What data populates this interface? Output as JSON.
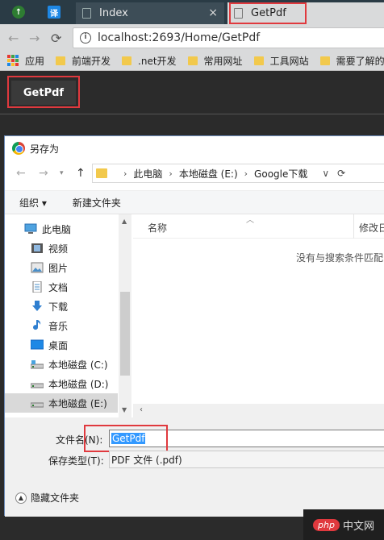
{
  "browser": {
    "pinned_tab_1_glyph": "↑",
    "pinned_tab_2_glyph": "译",
    "tabs": [
      {
        "title": "Index",
        "close": "×"
      },
      {
        "title": "GetPdf",
        "close": "×"
      }
    ],
    "url": "localhost:2693/Home/GetPdf",
    "nav": {
      "back": "←",
      "forward": "→",
      "reload": "⟳"
    },
    "bookmarks": [
      {
        "label": "应用"
      },
      {
        "label": "前端开发"
      },
      {
        "label": ".net开发"
      },
      {
        "label": "常用网址"
      },
      {
        "label": "工具网站"
      },
      {
        "label": "需要了解的内"
      }
    ]
  },
  "page": {
    "button_label": "GetPdf"
  },
  "dialog": {
    "title": "另存为",
    "breadcrumb": [
      "此电脑",
      "本地磁盘 (E:)",
      "Google下载"
    ],
    "command_bar": {
      "organize": "组织 ▾",
      "new_folder": "新建文件夹"
    },
    "nav_items": [
      {
        "label": "此电脑",
        "icon": "computer-icon"
      },
      {
        "label": "视频",
        "icon": "video-icon"
      },
      {
        "label": "图片",
        "icon": "pictures-icon"
      },
      {
        "label": "文档",
        "icon": "documents-icon"
      },
      {
        "label": "下载",
        "icon": "downloads-icon"
      },
      {
        "label": "音乐",
        "icon": "music-icon"
      },
      {
        "label": "桌面",
        "icon": "desktop-icon"
      },
      {
        "label": "本地磁盘 (C:)",
        "icon": "drive-icon"
      },
      {
        "label": "本地磁盘 (D:)",
        "icon": "drive-icon"
      },
      {
        "label": "本地磁盘 (E:)",
        "icon": "drive-icon",
        "selected": true
      }
    ],
    "columns": {
      "name": "名称",
      "modified": "修改日"
    },
    "empty_message": "没有与搜索条件匹配",
    "filename_label": "文件名(N):",
    "filename_value": "GetPdf",
    "filetype_label": "保存类型(T):",
    "filetype_value": "PDF 文件 (.pdf)",
    "hide_folders": "隐藏文件夹"
  },
  "watermark": {
    "logo": "php",
    "text": "中文网"
  },
  "colors": {
    "highlight": "#e0393e",
    "selection": "#3399ff",
    "folder": "#f2c94c"
  }
}
